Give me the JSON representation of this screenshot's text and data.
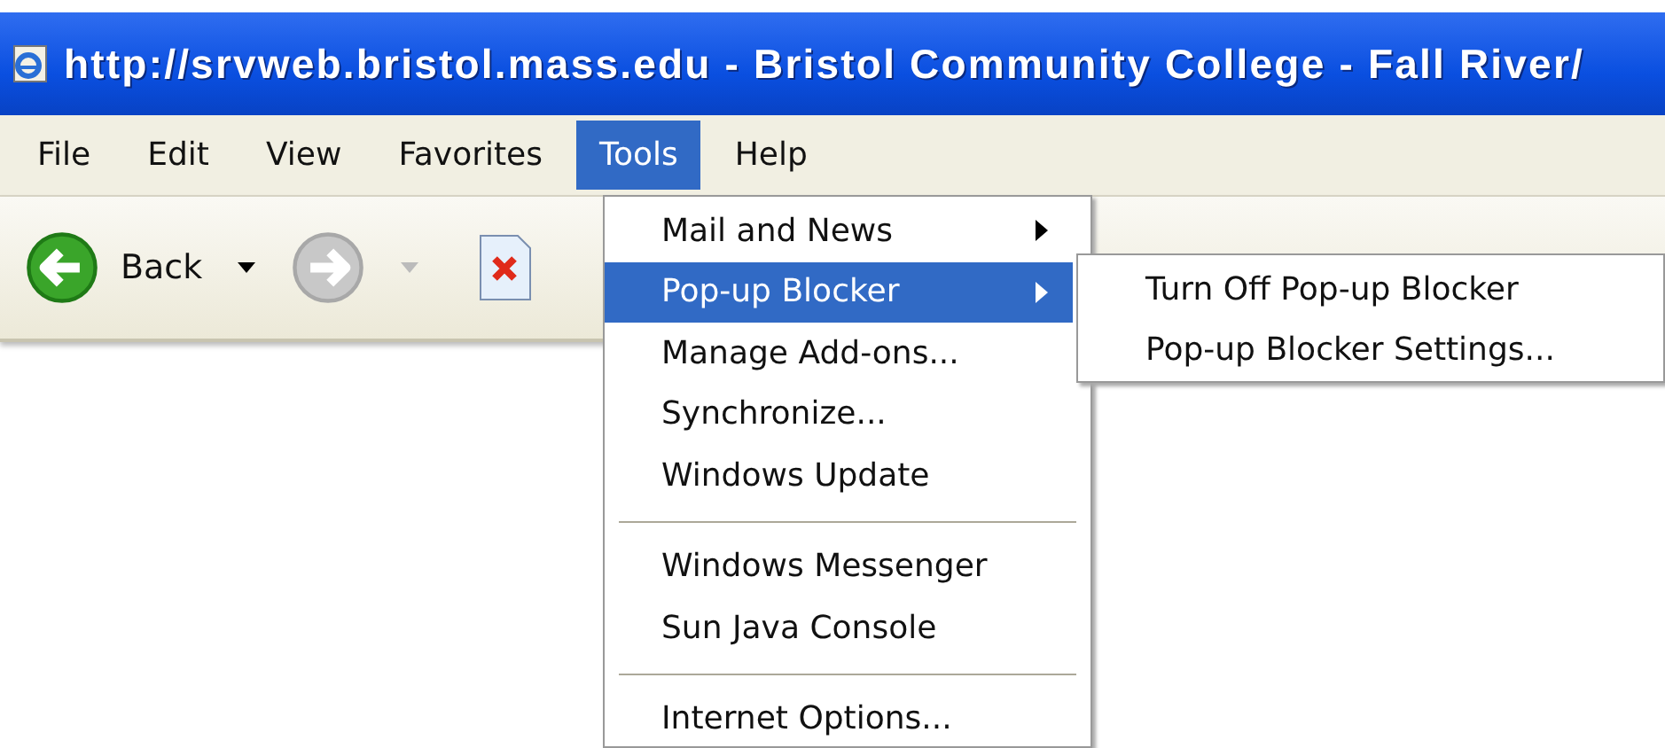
{
  "window": {
    "title": "http://srvweb.bristol.mass.edu - Bristol Community College - Fall River/"
  },
  "menu_bar": [
    {
      "label": "File",
      "selected": false
    },
    {
      "label": "Edit",
      "selected": false
    },
    {
      "label": "View",
      "selected": false
    },
    {
      "label": "Favorites",
      "selected": false
    },
    {
      "label": "Tools",
      "selected": true
    },
    {
      "label": "Help",
      "selected": false
    }
  ],
  "toolbar": {
    "back_label": "Back"
  },
  "tools_menu": [
    {
      "kind": "item",
      "label": "Mail and News",
      "submenu": true,
      "selected": false
    },
    {
      "kind": "item",
      "label": "Pop-up Blocker",
      "submenu": true,
      "selected": true
    },
    {
      "kind": "item",
      "label": "Manage Add-ons...",
      "submenu": false,
      "selected": false
    },
    {
      "kind": "item",
      "label": "Synchronize...",
      "submenu": false,
      "selected": false
    },
    {
      "kind": "item",
      "label": "Windows Update",
      "submenu": false,
      "selected": false
    },
    {
      "kind": "separator"
    },
    {
      "kind": "item",
      "label": "Windows Messenger",
      "submenu": false,
      "selected": false
    },
    {
      "kind": "item",
      "label": "Sun Java Console",
      "submenu": false,
      "selected": false
    },
    {
      "kind": "separator"
    },
    {
      "kind": "item",
      "label": "Internet Options...",
      "submenu": false,
      "selected": false
    }
  ],
  "submenu": [
    {
      "label": "Turn Off Pop-up Blocker",
      "selected": false
    },
    {
      "label": "Pop-up Blocker Settings...",
      "selected": false
    }
  ]
}
